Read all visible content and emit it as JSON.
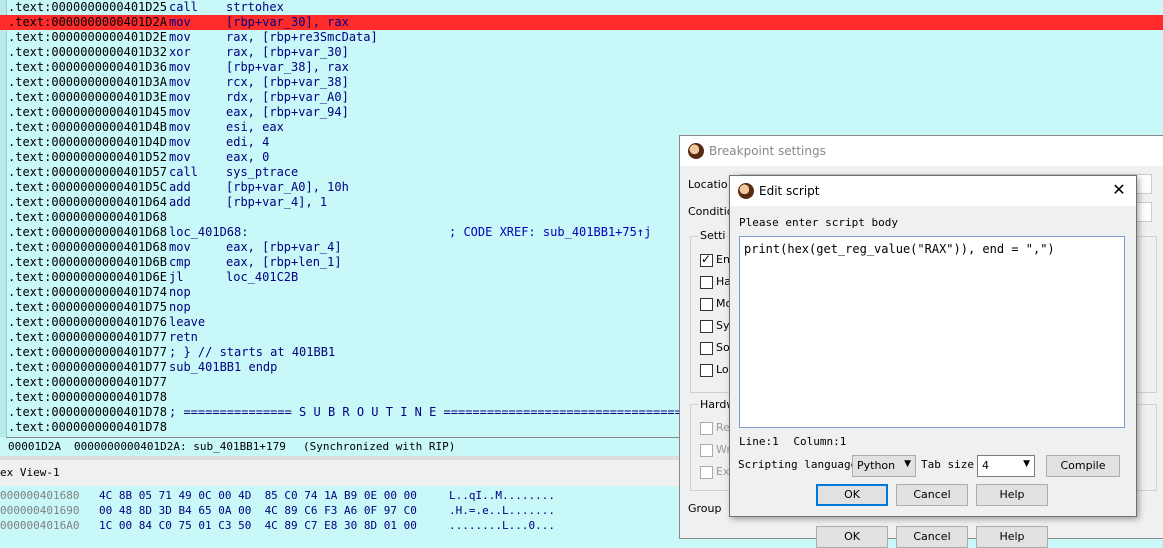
{
  "disasm": {
    "lines": [
      {
        "addr": ".text:0000000000401D25",
        "mn": "call",
        "ops": "strtohex",
        "cmt": ""
      },
      {
        "addr": ".text:0000000000401D2A",
        "mn": "mov",
        "ops": "[rbp+var_30], rax",
        "cmt": ""
      },
      {
        "addr": ".text:0000000000401D2E",
        "mn": "mov",
        "ops": "rax, [rbp+re3SmcData]",
        "cmt": ""
      },
      {
        "addr": ".text:0000000000401D32",
        "mn": "xor",
        "ops": "rax, [rbp+var_30]",
        "cmt": ""
      },
      {
        "addr": ".text:0000000000401D36",
        "mn": "mov",
        "ops": "[rbp+var_38], rax",
        "cmt": ""
      },
      {
        "addr": ".text:0000000000401D3A",
        "mn": "mov",
        "ops": "rcx, [rbp+var_38]",
        "cmt": ""
      },
      {
        "addr": ".text:0000000000401D3E",
        "mn": "mov",
        "ops": "rdx, [rbp+var_A0]",
        "cmt": ""
      },
      {
        "addr": ".text:0000000000401D45",
        "mn": "mov",
        "ops": "eax, [rbp+var_94]",
        "cmt": ""
      },
      {
        "addr": ".text:0000000000401D4B",
        "mn": "mov",
        "ops": "esi, eax",
        "cmt": ""
      },
      {
        "addr": ".text:0000000000401D4D",
        "mn": "mov",
        "ops": "edi, 4",
        "cmt": ""
      },
      {
        "addr": ".text:0000000000401D52",
        "mn": "mov",
        "ops": "eax, 0",
        "cmt": ""
      },
      {
        "addr": ".text:0000000000401D57",
        "mn": "call",
        "ops": "sys_ptrace",
        "cmt": ""
      },
      {
        "addr": ".text:0000000000401D5C",
        "mn": "add",
        "ops": "[rbp+var_A0], 10h",
        "cmt": ""
      },
      {
        "addr": ".text:0000000000401D64",
        "mn": "add",
        "ops": "[rbp+var_4], 1",
        "cmt": ""
      },
      {
        "addr": ".text:0000000000401D68",
        "mn": "",
        "ops": "",
        "cmt": ""
      },
      {
        "addr": ".text:0000000000401D68",
        "mn": "loc_401D68:",
        "ops": "",
        "cmt": "; CODE XREF: sub_401BB1+75↑j"
      },
      {
        "addr": ".text:0000000000401D68",
        "mn": "mov",
        "ops": "eax, [rbp+var_4]",
        "cmt": ""
      },
      {
        "addr": ".text:0000000000401D6B",
        "mn": "cmp",
        "ops": "eax, [rbp+len_1]",
        "cmt": ""
      },
      {
        "addr": ".text:0000000000401D6E",
        "mn": "jl",
        "ops": "loc_401C2B",
        "cmt": ""
      },
      {
        "addr": ".text:0000000000401D74",
        "mn": "nop",
        "ops": "",
        "cmt": ""
      },
      {
        "addr": ".text:0000000000401D75",
        "mn": "nop",
        "ops": "",
        "cmt": ""
      },
      {
        "addr": ".text:0000000000401D76",
        "mn": "leave",
        "ops": "",
        "cmt": ""
      },
      {
        "addr": ".text:0000000000401D77",
        "mn": "retn",
        "ops": "",
        "cmt": ""
      },
      {
        "addr": ".text:0000000000401D77",
        "mn": "; } // starts at 401BB1",
        "ops": "",
        "cmt": ""
      },
      {
        "addr": ".text:0000000000401D77",
        "mn": "sub_401BB1 endp",
        "ops": "",
        "cmt": ""
      },
      {
        "addr": ".text:0000000000401D77",
        "mn": "",
        "ops": "",
        "cmt": ""
      },
      {
        "addr": ".text:0000000000401D78",
        "mn": "",
        "ops": "",
        "cmt": ""
      },
      {
        "addr": ".text:0000000000401D78",
        "mn": "; =============== S U B R O U T I N E =======================================",
        "ops": "",
        "cmt": ""
      },
      {
        "addr": ".text:0000000000401D78",
        "mn": "",
        "ops": "",
        "cmt": ""
      }
    ],
    "highlight_index": 1,
    "highlight_color": "#ff2b2b"
  },
  "status": {
    "offset": "00001D2A",
    "location": "0000000000401D2A: sub_401BB1+179",
    "sync": "(Synchronized with RIP)"
  },
  "hex": {
    "title": "ex View-1",
    "rows": [
      {
        "addr": "000000401680",
        "bytes": "4C 8B 05 71 49 0C 00 4D  85 C0 74 1A B9 0E 00 00",
        "ascii": "L..qI..M........"
      },
      {
        "addr": "000000401690",
        "bytes": "00 48 8D 3D B4 65 0A 00  4C 89 C6 F3 A6 0F 97 C0",
        "ascii": ".H.=.e..L......."
      },
      {
        "addr": "0000004016A0",
        "bytes": "1C 00 84 C0 75 01 C3 50  4C 89 C7 E8 30 8D 01 00",
        "ascii": "........L...0..."
      }
    ]
  },
  "breakpoint": {
    "title": "Breakpoint settings",
    "location_label": "Locatio",
    "condition_label": "Conditio",
    "settings_label": "Setti",
    "options": [
      {
        "label": "En",
        "checked": true,
        "disabled": false
      },
      {
        "label": "Ha",
        "checked": false,
        "disabled": false
      },
      {
        "label": "Mo",
        "checked": false,
        "disabled": false
      },
      {
        "label": "Sy",
        "checked": false,
        "disabled": false
      },
      {
        "label": "So",
        "checked": false,
        "disabled": false
      },
      {
        "label": "Lo",
        "checked": false,
        "disabled": false
      }
    ],
    "hardware_label": "Hardw",
    "hw_options": [
      {
        "label": "Re",
        "checked": false,
        "disabled": true
      },
      {
        "label": "Wr",
        "checked": false,
        "disabled": true
      },
      {
        "label": "Ex",
        "checked": false,
        "disabled": true
      }
    ],
    "group_label": "Group",
    "ok_label": "OK",
    "cancel_label": "Cancel",
    "help_label": "Help"
  },
  "edit": {
    "title": "Edit script",
    "prompt": "Please enter script body",
    "script": "print(hex(get_reg_value(\"RAX\")), end = \",\")",
    "line_label": "Line:1",
    "column_label": "Column:1",
    "lang_label": "Scripting language",
    "lang_value": "Python",
    "tab_label": "Tab size",
    "tab_value": "4",
    "compile_label": "Compile",
    "ok_label": "OK",
    "cancel_label": "Cancel",
    "help_label": "Help"
  }
}
